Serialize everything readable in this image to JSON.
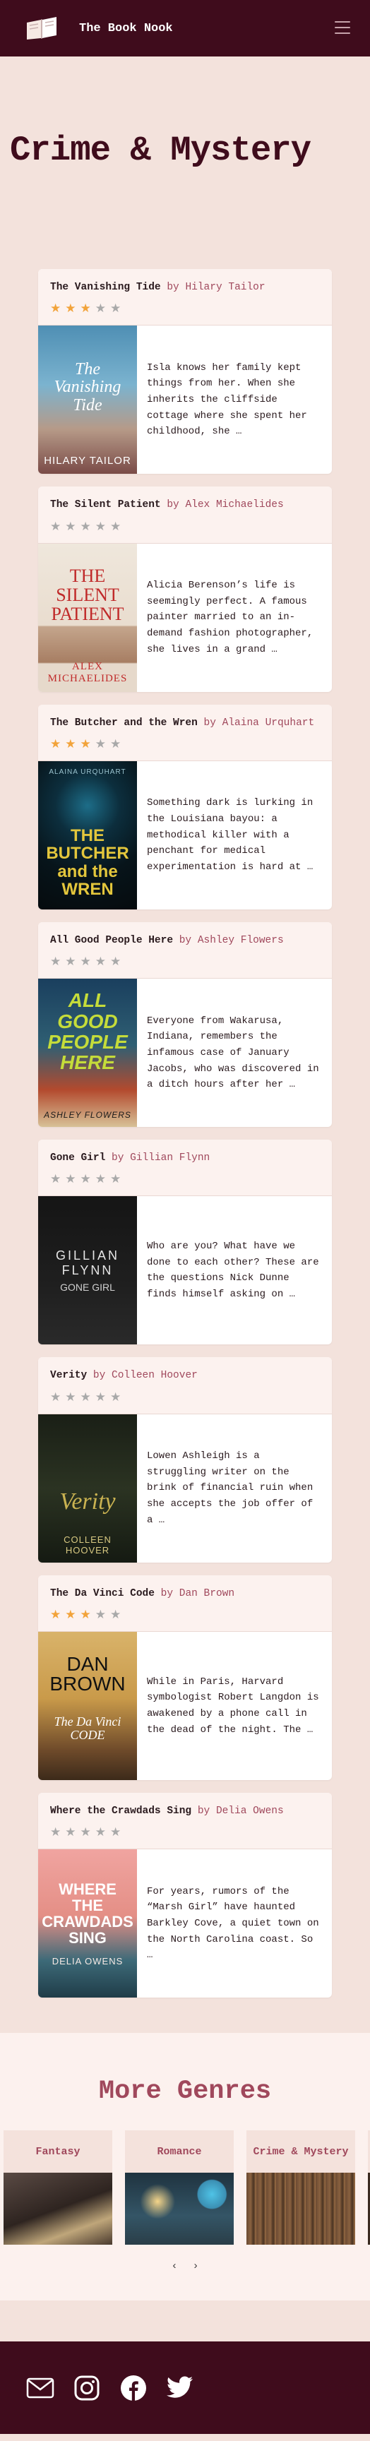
{
  "header": {
    "brand": "The Book Nook",
    "logo_icon": "open-book-icon",
    "menu_icon": "hamburger-menu-icon"
  },
  "page": {
    "title": "Crime & Mystery"
  },
  "books": [
    {
      "title": "The Vanishing Tide",
      "author_prefix": "by",
      "author": "Hilary Tailor",
      "rating": 3,
      "blurb": "Isla knows her family kept things from her. When she inherits the cliffside cottage where she spent her childhood, she …",
      "cover_title": "The Vanishing Tide",
      "cover_author": "HILARY TAILOR"
    },
    {
      "title": "The Silent Patient",
      "author_prefix": "by",
      "author": "Alex Michaelides",
      "rating": 0,
      "blurb": "Alicia Berenson’s life is seemingly perfect. A famous painter married to an in-demand fashion photographer, she lives in a grand …",
      "cover_title": "THE SILENT PATIENT",
      "cover_author": "ALEX MICHAELIDES"
    },
    {
      "title": "The Butcher and the Wren",
      "author_prefix": "by",
      "author": "Alaina Urquhart",
      "rating": 3,
      "blurb": "Something dark is lurking in the Louisiana bayou: a methodical killer with a penchant for medical experimentation is hard at …",
      "cover_title": "THE BUTCHER and the WREN",
      "cover_author": "ALAINA URQUHART"
    },
    {
      "title": "All Good People Here",
      "author_prefix": "by",
      "author": "Ashley Flowers",
      "rating": 0,
      "blurb": "Everyone from Wakarusa, Indiana, remembers the infamous case of January Jacobs, who was discovered in a ditch hours after her …",
      "cover_title": "ALL GOOD PEOPLE HERE",
      "cover_author": "ASHLEY FLOWERS"
    },
    {
      "title": "Gone Girl",
      "author_prefix": "by",
      "author": "Gillian Flynn",
      "rating": 0,
      "blurb": "Who are you? What have we done to each other? These are the questions Nick Dunne finds himself asking on …",
      "cover_title": "GONE GIRL",
      "cover_author": "GILLIAN FLYNN"
    },
    {
      "title": "Verity",
      "author_prefix": "by",
      "author": "Colleen Hoover",
      "rating": 0,
      "blurb": "Lowen Ashleigh is a struggling writer on the brink of financial ruin when she accepts the job offer of a …",
      "cover_title": "Verity",
      "cover_author": "COLLEEN HOOVER"
    },
    {
      "title": "The Da Vinci Code",
      "author_prefix": "by",
      "author": "Dan Brown",
      "rating": 3,
      "blurb": "While in Paris, Harvard symbologist Robert Langdon is awakened by a phone call in the dead of the night. The …",
      "cover_title": "The Da Vinci CODE",
      "cover_author": "DAN BROWN"
    },
    {
      "title": "Where the Crawdads Sing",
      "author_prefix": "by",
      "author": "Delia Owens",
      "rating": 0,
      "blurb": "For years, rumors of the “Marsh Girl” have haunted Barkley Cove, a quiet town on the North Carolina coast. So …",
      "cover_title": "WHERE THE CRAWDADS SING",
      "cover_author": "DELIA OWENS"
    }
  ],
  "genres": {
    "title": "More Genres",
    "items": [
      {
        "label": "Fantasy"
      },
      {
        "label": "Romance"
      },
      {
        "label": "Crime & Mystery"
      }
    ],
    "prev": "‹",
    "next": "›"
  },
  "footer": {
    "icons": [
      "mail-icon",
      "instagram-icon",
      "facebook-icon",
      "twitter-icon"
    ]
  },
  "colors": {
    "brand_dark": "#3f0c1c",
    "accent": "#a0485c",
    "background": "#f3e2dc",
    "star_on": "#f2a33a",
    "star_off": "#a9a9a9"
  }
}
